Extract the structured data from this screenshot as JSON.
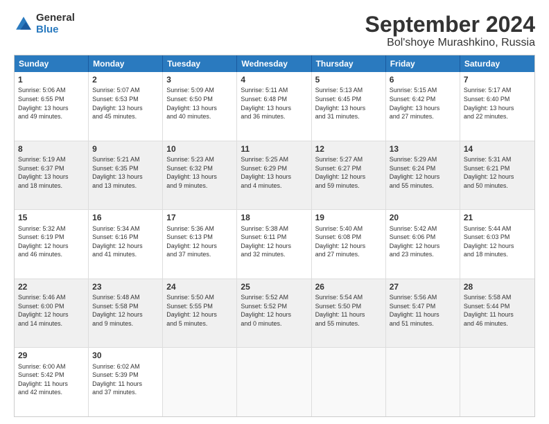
{
  "logo": {
    "general": "General",
    "blue": "Blue"
  },
  "title": "September 2024",
  "subtitle": "Bol'shoye Murashkino, Russia",
  "header_days": [
    "Sunday",
    "Monday",
    "Tuesday",
    "Wednesday",
    "Thursday",
    "Friday",
    "Saturday"
  ],
  "weeks": [
    [
      {
        "day": "1",
        "lines": [
          "Sunrise: 5:06 AM",
          "Sunset: 6:55 PM",
          "Daylight: 13 hours",
          "and 49 minutes."
        ],
        "shaded": false
      },
      {
        "day": "2",
        "lines": [
          "Sunrise: 5:07 AM",
          "Sunset: 6:53 PM",
          "Daylight: 13 hours",
          "and 45 minutes."
        ],
        "shaded": false
      },
      {
        "day": "3",
        "lines": [
          "Sunrise: 5:09 AM",
          "Sunset: 6:50 PM",
          "Daylight: 13 hours",
          "and 40 minutes."
        ],
        "shaded": false
      },
      {
        "day": "4",
        "lines": [
          "Sunrise: 5:11 AM",
          "Sunset: 6:48 PM",
          "Daylight: 13 hours",
          "and 36 minutes."
        ],
        "shaded": false
      },
      {
        "day": "5",
        "lines": [
          "Sunrise: 5:13 AM",
          "Sunset: 6:45 PM",
          "Daylight: 13 hours",
          "and 31 minutes."
        ],
        "shaded": false
      },
      {
        "day": "6",
        "lines": [
          "Sunrise: 5:15 AM",
          "Sunset: 6:42 PM",
          "Daylight: 13 hours",
          "and 27 minutes."
        ],
        "shaded": false
      },
      {
        "day": "7",
        "lines": [
          "Sunrise: 5:17 AM",
          "Sunset: 6:40 PM",
          "Daylight: 13 hours",
          "and 22 minutes."
        ],
        "shaded": false
      }
    ],
    [
      {
        "day": "8",
        "lines": [
          "Sunrise: 5:19 AM",
          "Sunset: 6:37 PM",
          "Daylight: 13 hours",
          "and 18 minutes."
        ],
        "shaded": true
      },
      {
        "day": "9",
        "lines": [
          "Sunrise: 5:21 AM",
          "Sunset: 6:35 PM",
          "Daylight: 13 hours",
          "and 13 minutes."
        ],
        "shaded": true
      },
      {
        "day": "10",
        "lines": [
          "Sunrise: 5:23 AM",
          "Sunset: 6:32 PM",
          "Daylight: 13 hours",
          "and 9 minutes."
        ],
        "shaded": true
      },
      {
        "day": "11",
        "lines": [
          "Sunrise: 5:25 AM",
          "Sunset: 6:29 PM",
          "Daylight: 13 hours",
          "and 4 minutes."
        ],
        "shaded": true
      },
      {
        "day": "12",
        "lines": [
          "Sunrise: 5:27 AM",
          "Sunset: 6:27 PM",
          "Daylight: 12 hours",
          "and 59 minutes."
        ],
        "shaded": true
      },
      {
        "day": "13",
        "lines": [
          "Sunrise: 5:29 AM",
          "Sunset: 6:24 PM",
          "Daylight: 12 hours",
          "and 55 minutes."
        ],
        "shaded": true
      },
      {
        "day": "14",
        "lines": [
          "Sunrise: 5:31 AM",
          "Sunset: 6:21 PM",
          "Daylight: 12 hours",
          "and 50 minutes."
        ],
        "shaded": true
      }
    ],
    [
      {
        "day": "15",
        "lines": [
          "Sunrise: 5:32 AM",
          "Sunset: 6:19 PM",
          "Daylight: 12 hours",
          "and 46 minutes."
        ],
        "shaded": false
      },
      {
        "day": "16",
        "lines": [
          "Sunrise: 5:34 AM",
          "Sunset: 6:16 PM",
          "Daylight: 12 hours",
          "and 41 minutes."
        ],
        "shaded": false
      },
      {
        "day": "17",
        "lines": [
          "Sunrise: 5:36 AM",
          "Sunset: 6:13 PM",
          "Daylight: 12 hours",
          "and 37 minutes."
        ],
        "shaded": false
      },
      {
        "day": "18",
        "lines": [
          "Sunrise: 5:38 AM",
          "Sunset: 6:11 PM",
          "Daylight: 12 hours",
          "and 32 minutes."
        ],
        "shaded": false
      },
      {
        "day": "19",
        "lines": [
          "Sunrise: 5:40 AM",
          "Sunset: 6:08 PM",
          "Daylight: 12 hours",
          "and 27 minutes."
        ],
        "shaded": false
      },
      {
        "day": "20",
        "lines": [
          "Sunrise: 5:42 AM",
          "Sunset: 6:06 PM",
          "Daylight: 12 hours",
          "and 23 minutes."
        ],
        "shaded": false
      },
      {
        "day": "21",
        "lines": [
          "Sunrise: 5:44 AM",
          "Sunset: 6:03 PM",
          "Daylight: 12 hours",
          "and 18 minutes."
        ],
        "shaded": false
      }
    ],
    [
      {
        "day": "22",
        "lines": [
          "Sunrise: 5:46 AM",
          "Sunset: 6:00 PM",
          "Daylight: 12 hours",
          "and 14 minutes."
        ],
        "shaded": true
      },
      {
        "day": "23",
        "lines": [
          "Sunrise: 5:48 AM",
          "Sunset: 5:58 PM",
          "Daylight: 12 hours",
          "and 9 minutes."
        ],
        "shaded": true
      },
      {
        "day": "24",
        "lines": [
          "Sunrise: 5:50 AM",
          "Sunset: 5:55 PM",
          "Daylight: 12 hours",
          "and 5 minutes."
        ],
        "shaded": true
      },
      {
        "day": "25",
        "lines": [
          "Sunrise: 5:52 AM",
          "Sunset: 5:52 PM",
          "Daylight: 12 hours",
          "and 0 minutes."
        ],
        "shaded": true
      },
      {
        "day": "26",
        "lines": [
          "Sunrise: 5:54 AM",
          "Sunset: 5:50 PM",
          "Daylight: 11 hours",
          "and 55 minutes."
        ],
        "shaded": true
      },
      {
        "day": "27",
        "lines": [
          "Sunrise: 5:56 AM",
          "Sunset: 5:47 PM",
          "Daylight: 11 hours",
          "and 51 minutes."
        ],
        "shaded": true
      },
      {
        "day": "28",
        "lines": [
          "Sunrise: 5:58 AM",
          "Sunset: 5:44 PM",
          "Daylight: 11 hours",
          "and 46 minutes."
        ],
        "shaded": true
      }
    ],
    [
      {
        "day": "29",
        "lines": [
          "Sunrise: 6:00 AM",
          "Sunset: 5:42 PM",
          "Daylight: 11 hours",
          "and 42 minutes."
        ],
        "shaded": false
      },
      {
        "day": "30",
        "lines": [
          "Sunrise: 6:02 AM",
          "Sunset: 5:39 PM",
          "Daylight: 11 hours",
          "and 37 minutes."
        ],
        "shaded": false
      },
      {
        "day": "",
        "lines": [],
        "shaded": false,
        "empty": true
      },
      {
        "day": "",
        "lines": [],
        "shaded": false,
        "empty": true
      },
      {
        "day": "",
        "lines": [],
        "shaded": false,
        "empty": true
      },
      {
        "day": "",
        "lines": [],
        "shaded": false,
        "empty": true
      },
      {
        "day": "",
        "lines": [],
        "shaded": false,
        "empty": true
      }
    ]
  ]
}
